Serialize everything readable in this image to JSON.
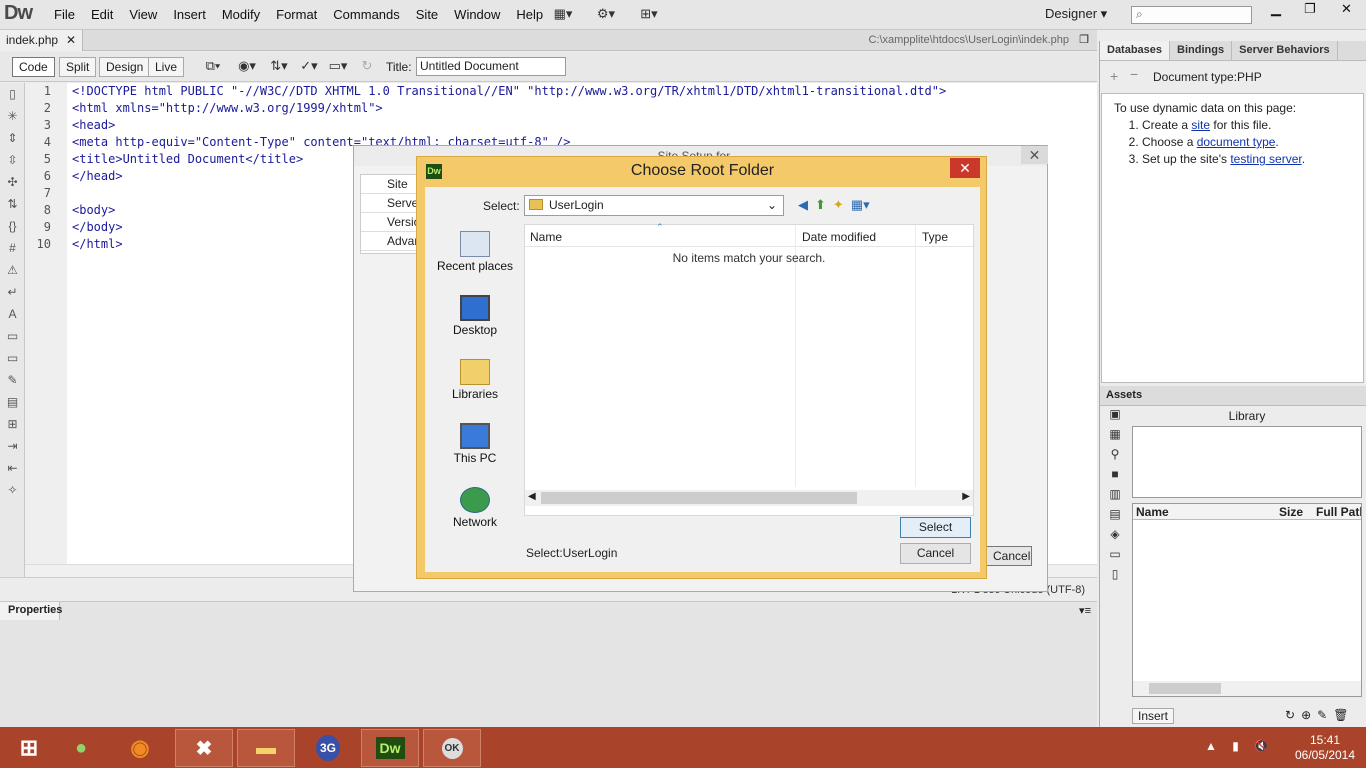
{
  "app": {
    "logo": "Dw",
    "workspace": "Designer"
  },
  "menu": [
    "File",
    "Edit",
    "View",
    "Insert",
    "Modify",
    "Format",
    "Commands",
    "Site",
    "Window",
    "Help"
  ],
  "document": {
    "tab_label": "indek.php",
    "path": "C:\\xampplite\\htdocs\\UserLogin\\indek.php",
    "views": [
      "Code",
      "Split",
      "Design",
      "Live"
    ],
    "title_label": "Title:",
    "title_value": "Untitled Document",
    "line_numbers": [
      "1",
      "2",
      "3",
      "4",
      "5",
      "6",
      "7",
      "8",
      "9",
      "10"
    ],
    "code_lines": [
      "<!DOCTYPE html PUBLIC \"-//W3C//DTD XHTML 1.0 Transitional//EN\" \"http://www.w3.org/TR/xhtml1/DTD/xhtml1-transitional.dtd\">",
      "<html xmlns=\"http://www.w3.org/1999/xhtml\">",
      "<head>",
      "<meta http-equiv=\"Content-Type\" content=\"text/html; charset=utf-8\" />",
      "<title>Untitled Document</title>",
      "</head>",
      "",
      "<body>",
      "</body>",
      "</html>"
    ],
    "status_text": "1K / 1 sec  Unicode (UTF-8)"
  },
  "properties": {
    "tab": "Properties"
  },
  "right_panel": {
    "tabs": [
      "Databases",
      "Bindings",
      "Server Behaviors"
    ],
    "doc_type": "Document type:PHP",
    "intro": "To use dynamic data on this page:",
    "steps": [
      {
        "pre": "Create a ",
        "link": "site",
        "post": " for this file."
      },
      {
        "pre": "Choose a ",
        "link": "document type",
        "post": "."
      },
      {
        "pre": "Set up the site's ",
        "link": "testing server",
        "post": "."
      }
    ],
    "assets_tab": "Assets",
    "library_title": "Library",
    "library_cols": [
      "Name",
      "Size",
      "Full Path"
    ],
    "insert_label": "Insert"
  },
  "site_setup": {
    "title": "Site Setup for ...",
    "nav": [
      "Site",
      "Servers",
      "Version Control",
      "Advanced Settings"
    ],
    "cancel": "Cancel"
  },
  "dialog": {
    "title": "Choose Root Folder",
    "select_label": "Select:",
    "select_value": "UserLogin",
    "places": [
      "Recent places",
      "Desktop",
      "Libraries",
      "This PC",
      "Network"
    ],
    "columns": [
      "Name",
      "Date modified",
      "Type"
    ],
    "empty_text": "No items match your search.",
    "select_button": "Select",
    "cancel_button": "Cancel",
    "selection_status": "Select:UserLogin"
  },
  "taskbar": {
    "apps": [
      "start",
      "frog",
      "firefox",
      "xampp",
      "explorer",
      "3G",
      "Dw",
      "OK"
    ],
    "time": "15:41",
    "date": "06/05/2014"
  }
}
